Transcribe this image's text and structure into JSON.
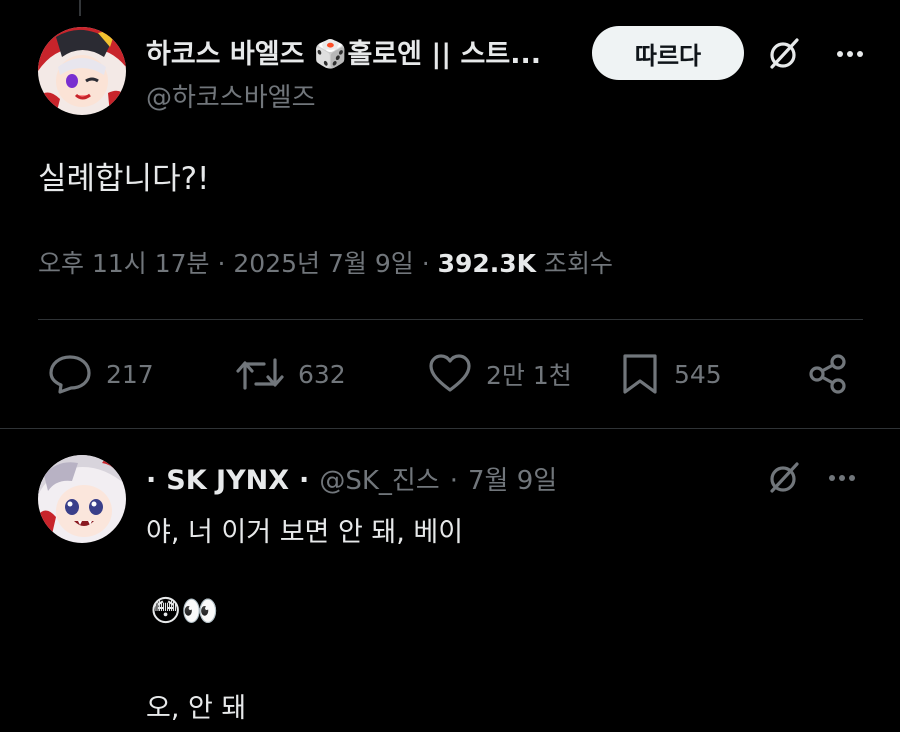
{
  "tweet": {
    "display_name": "하코스 바엘즈",
    "display_name_emoji": "🎲",
    "display_name_rest": "홀로엔 || 스트...",
    "handle": "@하코스바엘즈",
    "follow_label": "따르다",
    "text": "실례합니다?!",
    "time": "오후 11시 17분",
    "date": "2025년 7월 9일",
    "views_count": "392.3K",
    "views_label": "조회수",
    "separator": "·"
  },
  "actions": {
    "replies": "217",
    "reposts": "632",
    "likes": "2만 1천",
    "bookmarks": "545"
  },
  "reply": {
    "prefix_dot": "·",
    "display_name": "SK JYNX",
    "suffix_dot": "·",
    "handle": "@SK_진스",
    "date": "7월 9일",
    "line1": "야, 너 이거 보면 안 돼, 베이",
    "emoji_line": "😳👀",
    "line3": "오, 안 돼"
  },
  "icons": [
    "grok-icon",
    "more-icon",
    "reply-icon",
    "repost-icon",
    "like-icon",
    "bookmark-icon",
    "share-icon"
  ],
  "colors": {
    "background": "#000000",
    "text": "#e7e9ea",
    "muted": "#71767b",
    "divider": "#2f3336",
    "button": "#eff3f4"
  }
}
